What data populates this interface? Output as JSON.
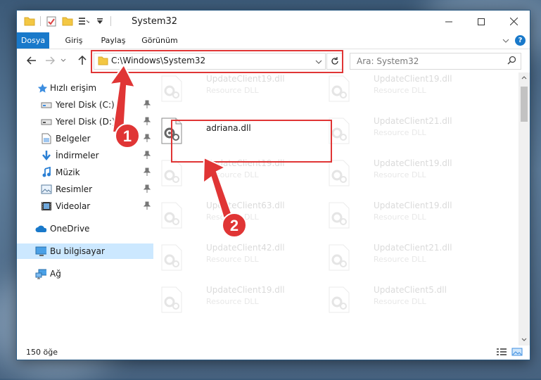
{
  "window": {
    "title": "System32",
    "controls": {
      "minimize": "minimize",
      "maximize": "maximize",
      "close": "close"
    }
  },
  "ribbon": {
    "tabs": [
      "Dosya",
      "Giriş",
      "Paylaş",
      "Görünüm"
    ],
    "help_icon": "?"
  },
  "navbar": {
    "address": "C:\\Windows\\System32",
    "search_placeholder": "Ara: System32"
  },
  "sidebar": {
    "quick_access": "Hızlı erişim",
    "items": [
      {
        "label": "Yerel Disk (C:)",
        "icon": "drive-icon",
        "pinned": true
      },
      {
        "label": "Yerel Disk (D:)",
        "icon": "drive-icon",
        "pinned": true
      },
      {
        "label": "Belgeler",
        "icon": "documents-icon",
        "pinned": true
      },
      {
        "label": "İndirmeler",
        "icon": "download-icon",
        "pinned": true
      },
      {
        "label": "Müzik",
        "icon": "music-icon",
        "pinned": true
      },
      {
        "label": "Resimler",
        "icon": "pictures-icon",
        "pinned": true
      },
      {
        "label": "Videolar",
        "icon": "video-icon",
        "pinned": true
      }
    ],
    "onedrive": "OneDrive",
    "this_pc": "Bu bilgisayar",
    "network": "Ağ"
  },
  "files": [
    {
      "name": "UpdateClient19.dll",
      "type": "Resource DLL",
      "faded": true
    },
    {
      "name": "UpdateClient19.dll",
      "type": "Resource DLL",
      "faded": true
    },
    {
      "name": "adriana.dll",
      "type": "",
      "faded": false
    },
    {
      "name": "UpdateClient21.dll",
      "type": "Resource DLL",
      "faded": true
    },
    {
      "name": "UpdateClient19.dll",
      "type": "Resource DLL",
      "faded": true
    },
    {
      "name": "UpdateClient19.dll",
      "type": "Resource DLL",
      "faded": true
    },
    {
      "name": "UpdateClient63.dll",
      "type": "Resource DLL",
      "faded": true
    },
    {
      "name": "UpdateClient19.dll",
      "type": "Resource DLL",
      "faded": true
    },
    {
      "name": "UpdateClient42.dll",
      "type": "Resource DLL",
      "faded": true
    },
    {
      "name": "UpdateClient21.dll",
      "type": "Resource DLL",
      "faded": true
    },
    {
      "name": "UpdateClient19.dll",
      "type": "Resource DLL",
      "faded": true
    },
    {
      "name": "UpdateClient5.dll",
      "type": "Resource DLL",
      "faded": true
    }
  ],
  "status": {
    "count": "150 öğe"
  },
  "annotations": {
    "step1": "1",
    "step2": "2",
    "color": "#e03535"
  }
}
